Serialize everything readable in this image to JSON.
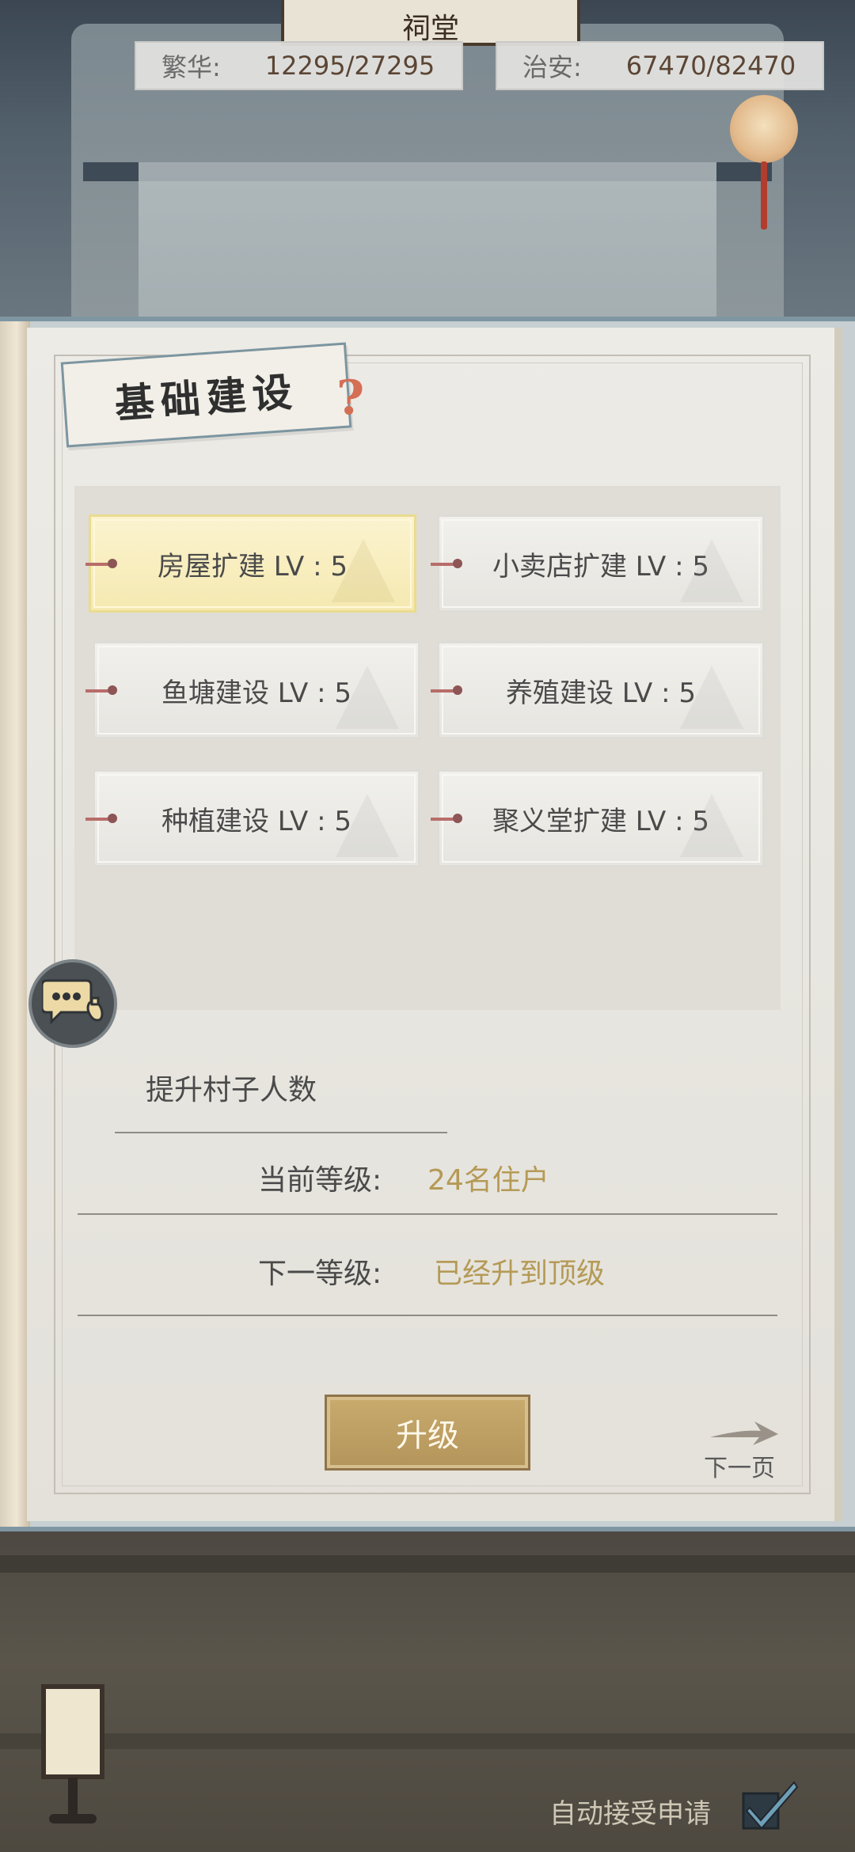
{
  "header": {
    "plaque_text": "祠堂",
    "prosperity": {
      "label": "繁华:",
      "value": "12295/27295"
    },
    "security": {
      "label": "治安:",
      "value": "67470/82470"
    }
  },
  "panel": {
    "title": "基础建设",
    "buildings": [
      {
        "label": "房屋扩建 LV : 5",
        "active": true
      },
      {
        "label": "小卖店扩建 LV : 5",
        "active": false
      },
      {
        "label": "鱼塘建设 LV : 5",
        "active": false
      },
      {
        "label": "养殖建设 LV : 5",
        "active": false
      },
      {
        "label": "种植建设 LV : 5",
        "active": false
      },
      {
        "label": "聚义堂扩建 LV : 5",
        "active": false
      }
    ],
    "description": "提升村子人数",
    "current_level": {
      "label": "当前等级:",
      "value": "24名住户"
    },
    "next_level": {
      "label": "下一等级:",
      "value": "已经升到顶级"
    },
    "upgrade_label": "升级",
    "next_page_label": "下一页"
  },
  "footer": {
    "auto_accept_label": "自动接受申请",
    "auto_accept_checked": true
  },
  "colors": {
    "accent_gold": "#b59a56",
    "active_card": "#f5e9b1",
    "frame_blue": "#7f96a2"
  }
}
